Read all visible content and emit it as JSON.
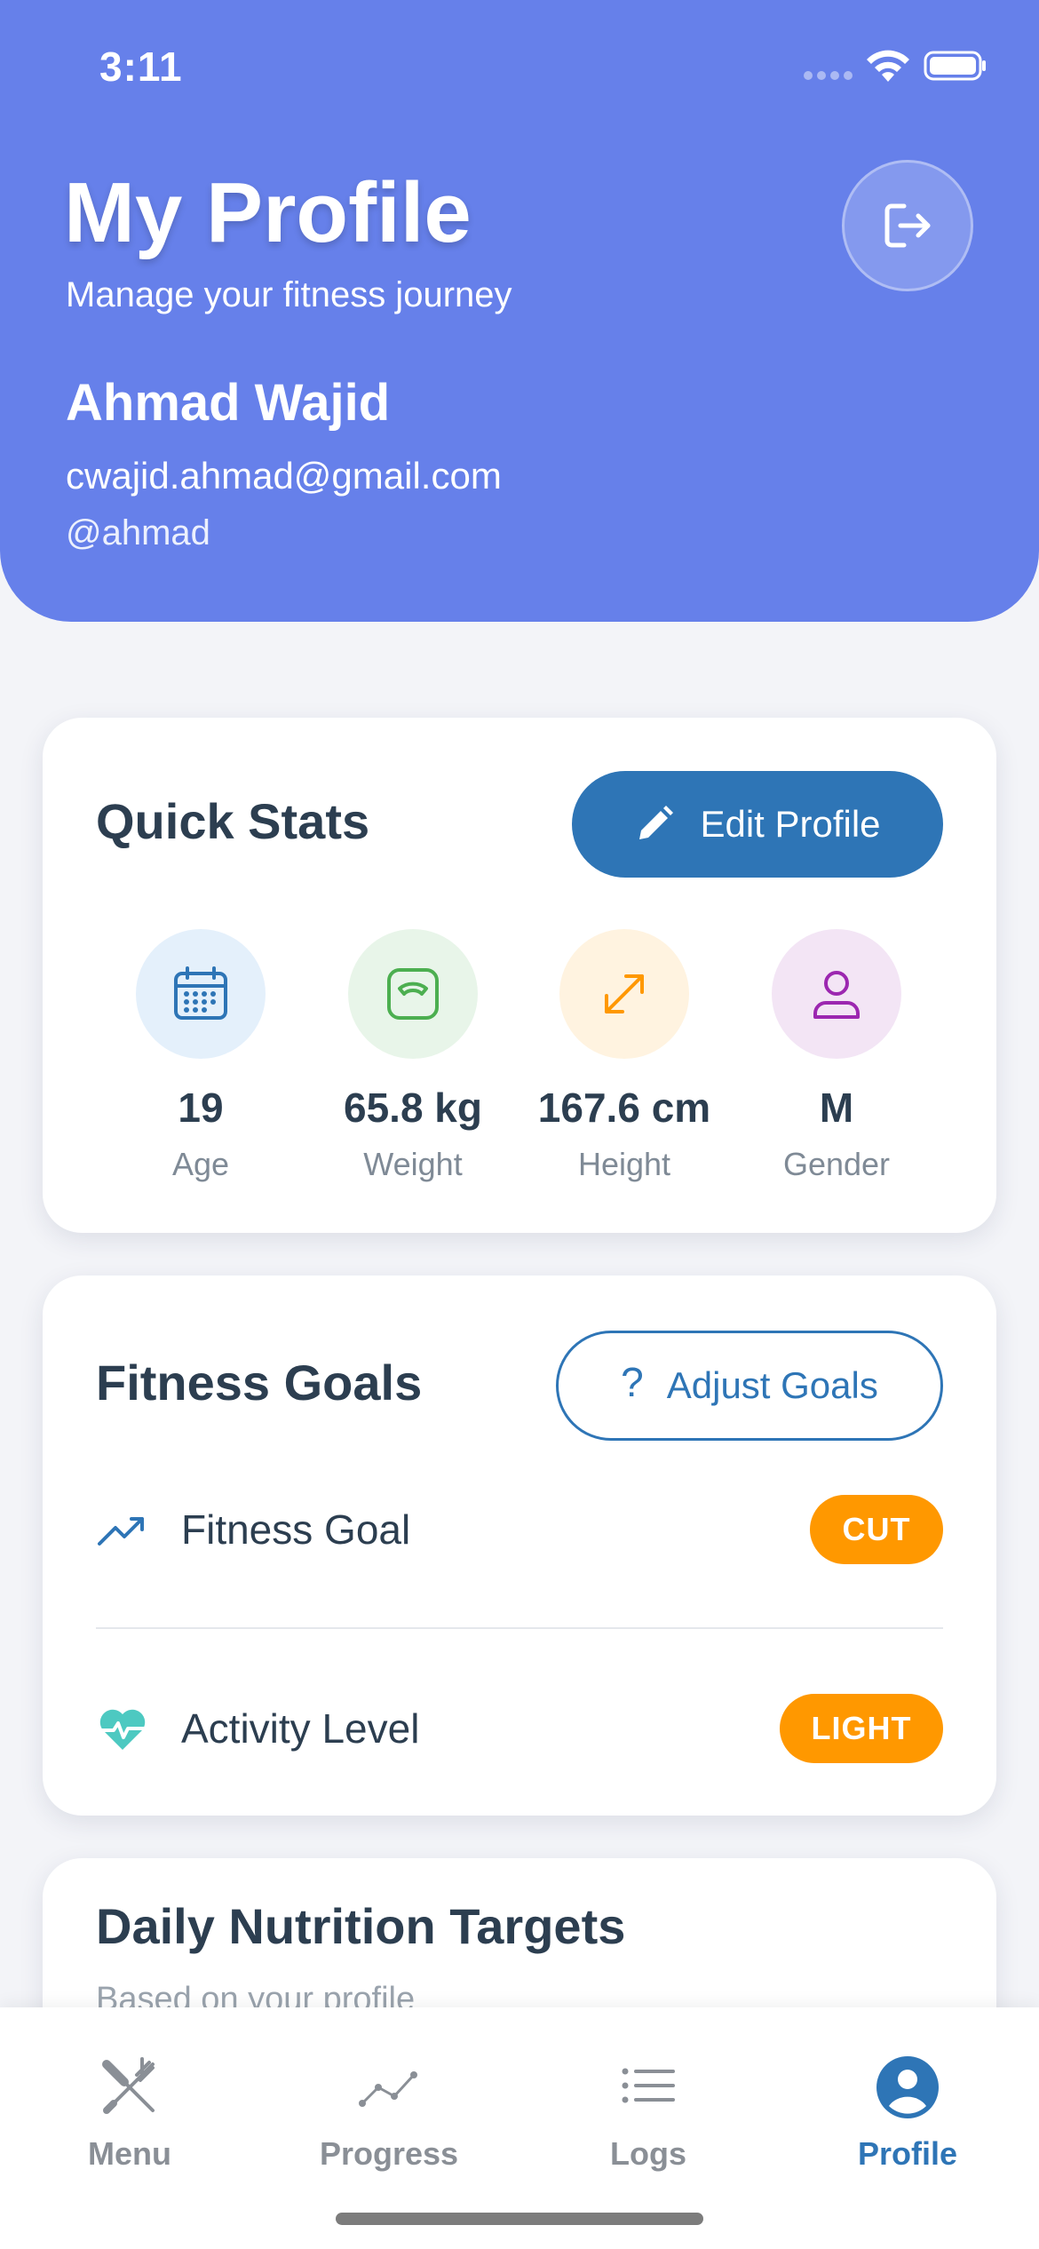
{
  "status_bar": {
    "time": "3:11"
  },
  "header": {
    "title": "My Profile",
    "subtitle": "Manage your fitness journey",
    "logout_icon": "logout-icon"
  },
  "user": {
    "name": "Ahmad Wajid",
    "email": "cwajid.ahmad@gmail.com",
    "handle": "@ahmad"
  },
  "quick_stats": {
    "title": "Quick Stats",
    "edit_button_label": "Edit Profile",
    "edit_button_icon": "pencil-icon",
    "items": [
      {
        "value": "19",
        "label": "Age",
        "icon": "calendar-icon",
        "color": "#2e75b6",
        "bg": "#e4f0fb"
      },
      {
        "value": "65.8 kg",
        "label": "Weight",
        "icon": "scale-icon",
        "color": "#4caf50",
        "bg": "#e8f5e9"
      },
      {
        "value": "167.6 cm",
        "label": "Height",
        "icon": "resize-arrows-icon",
        "color": "#ff9800",
        "bg": "#fff3e0"
      },
      {
        "value": "M",
        "label": "Gender",
        "icon": "person-icon",
        "color": "#9c27b0",
        "bg": "#f3e5f5"
      }
    ]
  },
  "fitness_goals": {
    "title": "Fitness Goals",
    "adjust_button_label": "Adjust Goals",
    "adjust_button_icon": "question-icon",
    "rows": [
      {
        "label": "Fitness Goal",
        "badge": "CUT",
        "icon": "trending-up-icon"
      },
      {
        "label": "Activity Level",
        "badge": "LIGHT",
        "icon": "heart-pulse-icon"
      }
    ]
  },
  "nutrition": {
    "title": "Daily Nutrition Targets",
    "subtitle": "Based on your profile"
  },
  "tabs": [
    {
      "label": "Menu",
      "icon": "fork-knife-icon",
      "active": false
    },
    {
      "label": "Progress",
      "icon": "chart-line-icon",
      "active": false
    },
    {
      "label": "Logs",
      "icon": "list-icon",
      "active": false
    },
    {
      "label": "Profile",
      "icon": "account-circle-icon",
      "active": true
    }
  ],
  "colors": {
    "header_bg": "#6680ea",
    "primary": "#2e75b6",
    "badge": "#ff9800",
    "page_bg": "#f3f4f8"
  }
}
